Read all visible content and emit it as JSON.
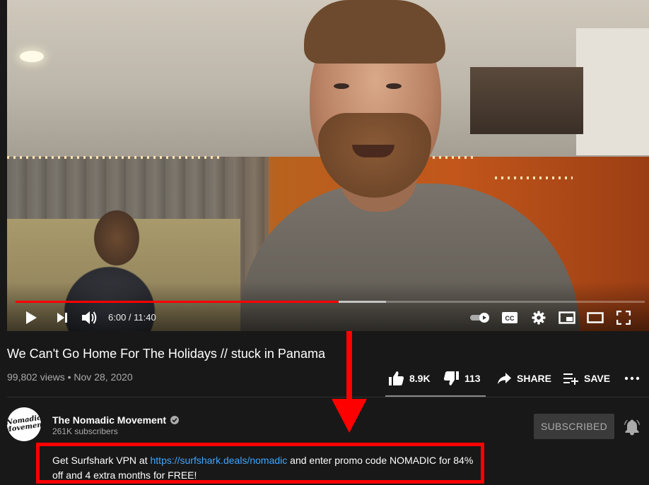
{
  "player": {
    "current_time": "6:00",
    "duration": "11:40",
    "time_display": "6:00 / 11:40",
    "progress_played": 0.514,
    "progress_buffered": 0.589,
    "colors": {
      "played": "#ff0000",
      "buffered": "#ffffff"
    }
  },
  "video": {
    "title": "We Can't Go Home For The Holidays // stuck in Panama",
    "views": "99,802 views",
    "date": "Nov 28, 2020",
    "meta_line": "99,802 views • Nov 28, 2020"
  },
  "actions": {
    "likes": "8.9K",
    "dislikes": "113",
    "share_label": "SHARE",
    "save_label": "SAVE"
  },
  "channel": {
    "name": "The Nomadic Movement",
    "subscribers": "261K subscribers",
    "avatar_text": "Nomadic Movement",
    "subscribe_label": "SUBSCRIBED"
  },
  "description": {
    "prefix": "Get Surfshark VPN at ",
    "link_text": "https://surfshark.deals/nomadic",
    "suffix": " and enter promo code NOMADIC for 84% off and 4 extra months for FREE!",
    "link_color": "#3ea6ff"
  },
  "annotation": {
    "color": "#ff0000"
  },
  "icons": {
    "play": "play-icon",
    "next": "next-icon",
    "volume": "volume-icon",
    "autoplay": "autoplay-toggle-icon",
    "captions": "captions-icon",
    "settings": "gear-icon",
    "miniplayer": "miniplayer-icon",
    "theater": "theater-mode-icon",
    "fullscreen": "fullscreen-icon",
    "like": "thumbs-up-icon",
    "dislike": "thumbs-down-icon",
    "share": "share-arrow-icon",
    "save": "playlist-add-icon",
    "more": "more-horizontal-icon",
    "verified": "verified-check-icon",
    "bell": "bell-icon"
  }
}
